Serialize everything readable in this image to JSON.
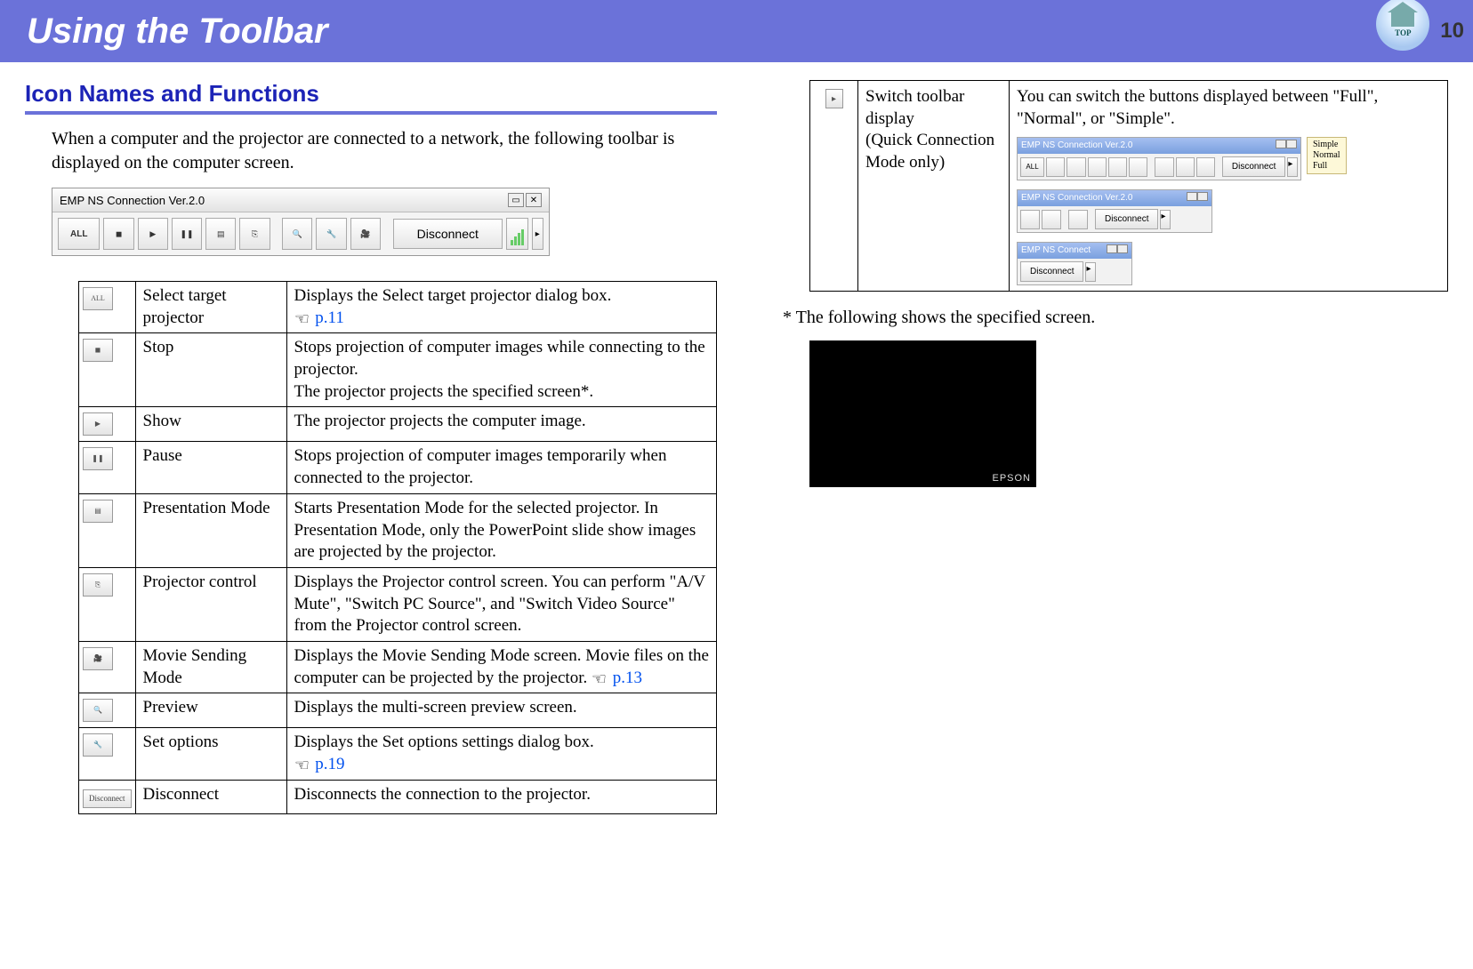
{
  "header": {
    "title": "Using the Toolbar",
    "top_label": "TOP",
    "page_number": "10"
  },
  "section_title": "Icon Names and Functions",
  "intro_text": "When a computer and the projector are connected to a network, the following toolbar is displayed on the computer screen.",
  "toolbar": {
    "window_title": "EMP NS Connection Ver.2.0",
    "all_label": "ALL",
    "disconnect_label": "Disconnect"
  },
  "rows": [
    {
      "icon": "ALL",
      "name": "Select target projector",
      "desc": "Displays the Select target projector dialog box.",
      "link": "p.11"
    },
    {
      "icon": "stop",
      "name": "Stop",
      "desc": "Stops projection of computer images while connecting to the projector.\nThe projector projects the specified screen*."
    },
    {
      "icon": "show",
      "name": "Show",
      "desc": "The projector projects the computer image."
    },
    {
      "icon": "pause",
      "name": "Pause",
      "desc": "Stops projection of computer images temporarily when connected to the projector."
    },
    {
      "icon": "present",
      "name": "Presentation Mode",
      "desc": "Starts Presentation Mode for the selected projector. In Presentation Mode, only the PowerPoint slide show images are projected by the projector."
    },
    {
      "icon": "control",
      "name": "Projector control",
      "desc": "Displays the Projector control screen. You can perform \"A/V Mute\", \"Switch PC Source\", and \"Switch Video Source\" from the Projector control screen."
    },
    {
      "icon": "movie",
      "name": "Movie Sending Mode",
      "desc": "Displays the Movie Sending Mode screen. Movie files on the computer can be projected by the projector. ",
      "link": "p.13"
    },
    {
      "icon": "preview",
      "name": "Preview",
      "desc": "Displays the multi-screen preview screen."
    },
    {
      "icon": "options",
      "name": "Set options",
      "desc": "Displays the Set options settings dialog box.",
      "link": "p.19"
    },
    {
      "icon": "disconnect",
      "name": "Disconnect",
      "desc": "Disconnects the connection to the projector."
    }
  ],
  "right_row": {
    "name": "Switch toolbar display\n(Quick Connection Mode only)",
    "desc": "You can switch the buttons displayed between \"Full\", \"Normal\", or \"Simple\".",
    "tooltip_lines": "Simple\nNormal\nFull",
    "mini_title": "EMP NS Connection Ver.2.0",
    "mini_title_short": "EMP NS Connect",
    "mini_all": "ALL",
    "mini_disconnect": "Disconnect"
  },
  "footnote": "* The following shows the specified screen.",
  "brand": "EPSON"
}
